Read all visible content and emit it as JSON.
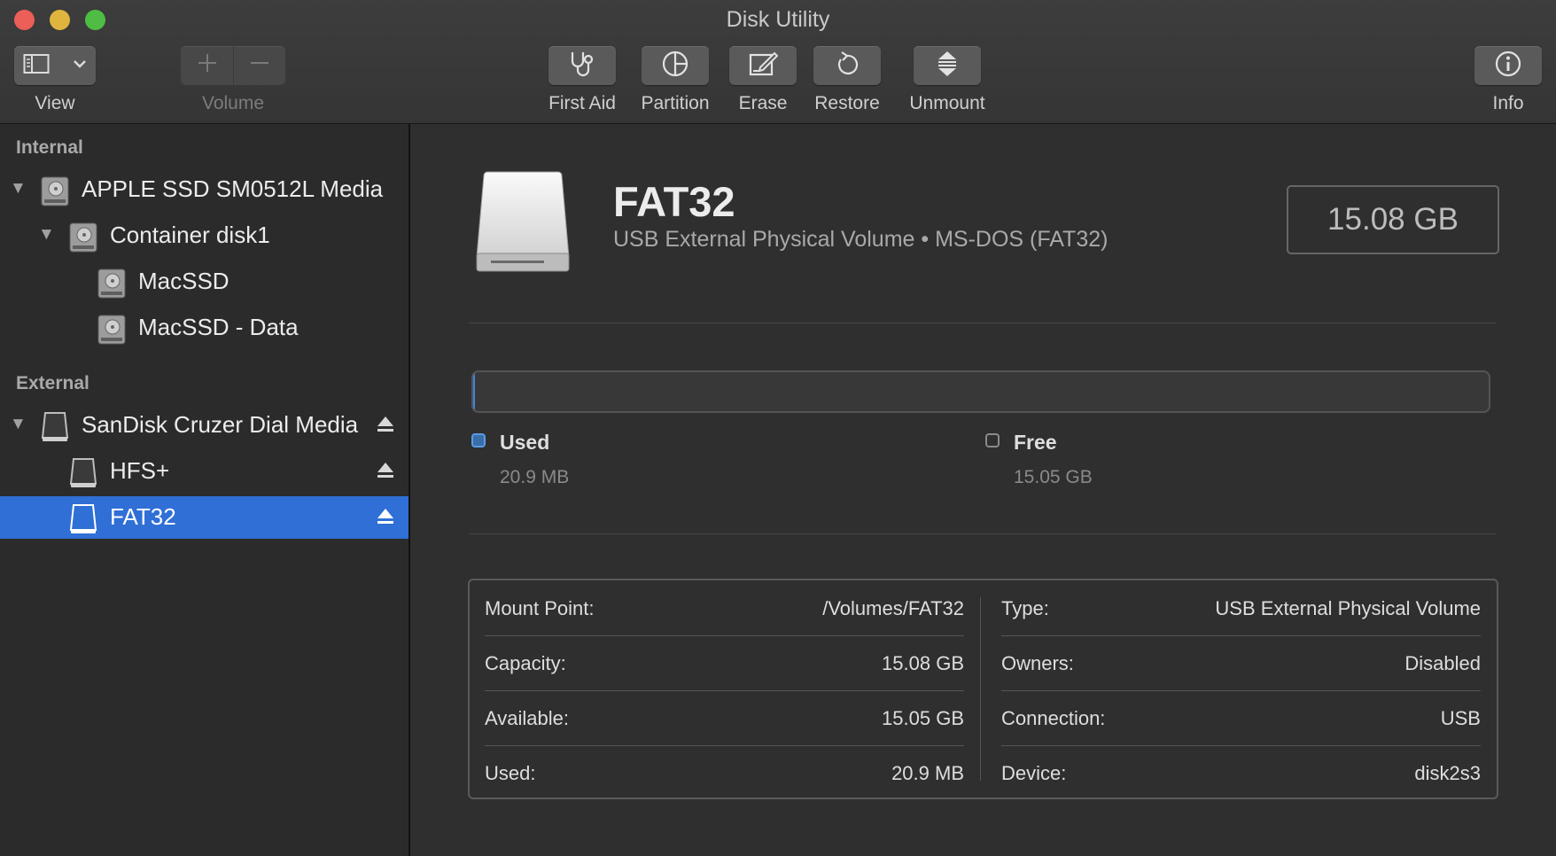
{
  "window": {
    "title": "Disk Utility"
  },
  "toolbar": {
    "view_label": "View",
    "volume_label": "Volume",
    "first_aid_label": "First Aid",
    "partition_label": "Partition",
    "erase_label": "Erase",
    "restore_label": "Restore",
    "unmount_label": "Unmount",
    "info_label": "Info"
  },
  "sidebar": {
    "internal_label": "Internal",
    "external_label": "External",
    "items": [
      {
        "label": "APPLE SSD SM0512L Media",
        "icon": "internal-drive-icon",
        "expanded": true
      },
      {
        "label": "Container disk1",
        "icon": "internal-drive-icon",
        "expanded": true
      },
      {
        "label": "MacSSD",
        "icon": "internal-drive-icon"
      },
      {
        "label": "MacSSD - Data",
        "icon": "internal-drive-icon"
      },
      {
        "label": "SanDisk Cruzer Dial Media",
        "icon": "external-drive-icon",
        "expanded": true,
        "ejectable": true
      },
      {
        "label": "HFS+",
        "icon": "external-drive-icon",
        "ejectable": true
      },
      {
        "label": "FAT32",
        "icon": "external-drive-icon",
        "ejectable": true,
        "selected": true
      }
    ]
  },
  "volume": {
    "name": "FAT32",
    "description": "USB External Physical Volume • MS-DOS (FAT32)",
    "capacity": "15.08 GB"
  },
  "usage": {
    "used_fraction": 0.0014,
    "used_label": "Used",
    "used_value": "20.9 MB",
    "free_label": "Free",
    "free_value": "15.05 GB"
  },
  "info": {
    "left": [
      {
        "key": "Mount Point:",
        "value": "/Volumes/FAT32"
      },
      {
        "key": "Capacity:",
        "value": "15.08 GB"
      },
      {
        "key": "Available:",
        "value": "15.05 GB"
      },
      {
        "key": "Used:",
        "value": "20.9 MB"
      }
    ],
    "right": [
      {
        "key": "Type:",
        "value": "USB External Physical Volume"
      },
      {
        "key": "Owners:",
        "value": "Disabled"
      },
      {
        "key": "Connection:",
        "value": "USB"
      },
      {
        "key": "Device:",
        "value": "disk2s3"
      }
    ]
  },
  "colors": {
    "accent": "#2f6fd6",
    "used": "#3e86e0"
  }
}
